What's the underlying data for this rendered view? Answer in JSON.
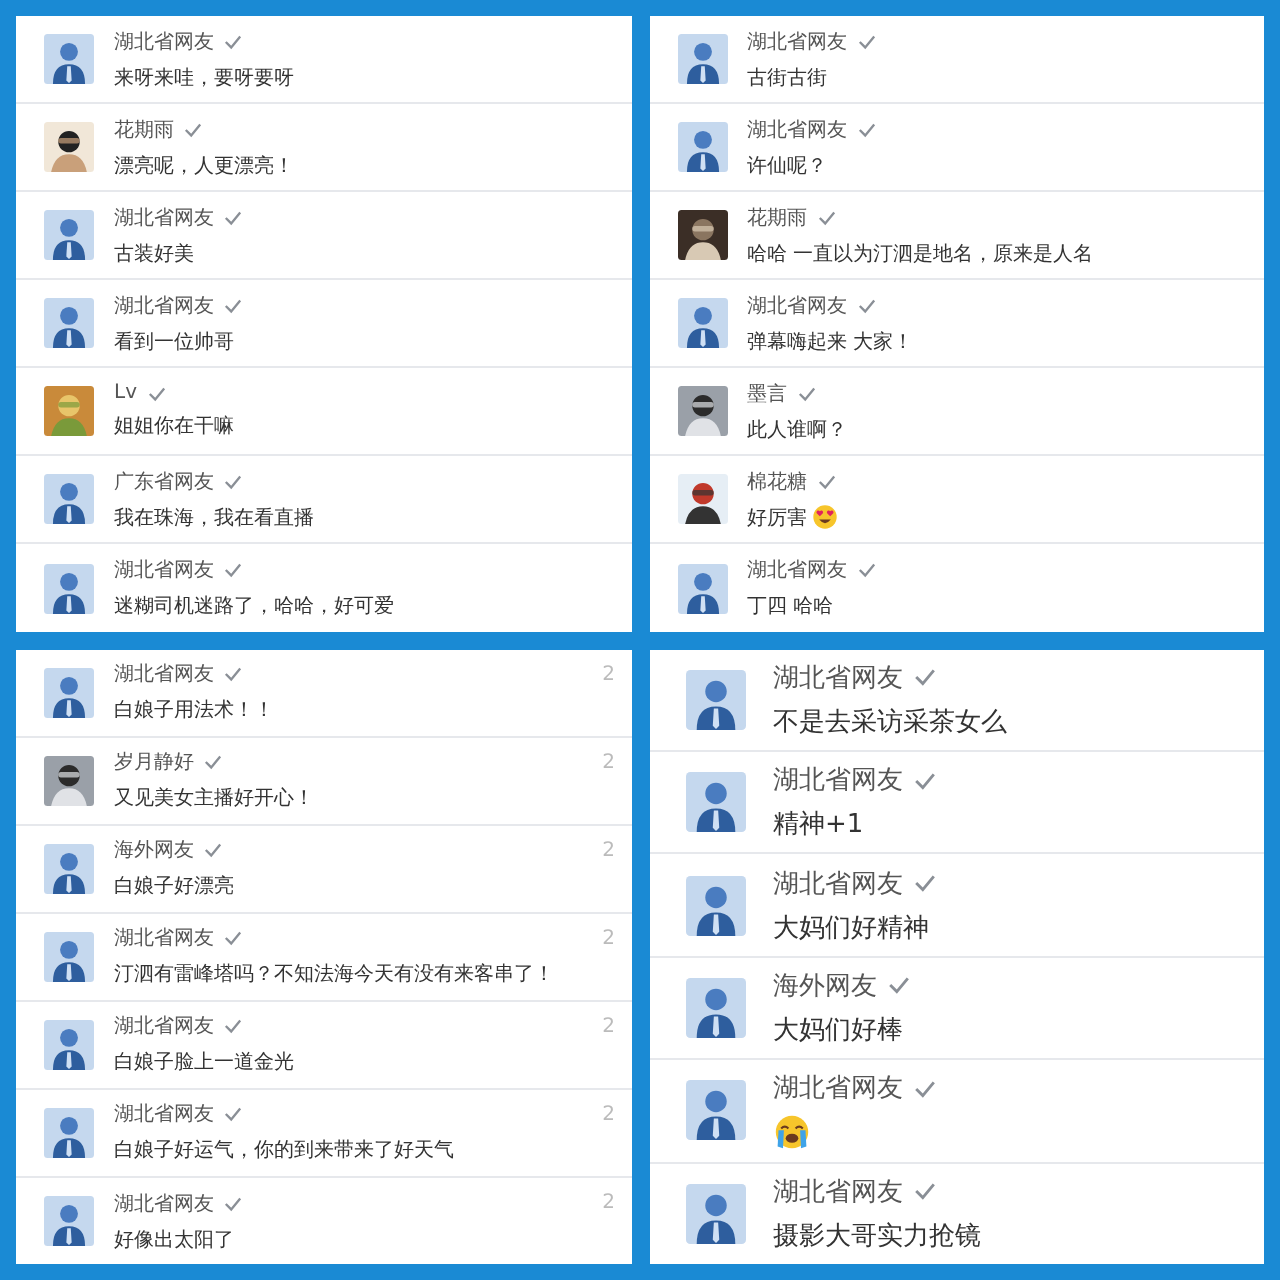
{
  "panels": [
    {
      "comments": [
        {
          "avatar": {
            "kind": "default"
          },
          "name": "湖北省网友",
          "text": "来呀来哇，要呀要呀"
        },
        {
          "name": "花期雨",
          "text": "漂亮呢，人更漂亮！"
        },
        {
          "avatar": {
            "kind": "default"
          },
          "name": "湖北省网友",
          "text": "古装好美"
        },
        {
          "avatar": {
            "kind": "default"
          },
          "name": "湖北省网友",
          "text": "看到一位帅哥"
        },
        {
          "name": "Lv",
          "text": "姐姐你在干嘛"
        },
        {
          "avatar": {
            "kind": "default"
          },
          "name": "广东省网友",
          "text": "我在珠海，我在看直播"
        },
        {
          "avatar": {
            "kind": "default"
          },
          "name": "湖北省网友",
          "text": "迷糊司机迷路了，哈哈，好可爱"
        }
      ]
    },
    {
      "comments": [
        {
          "avatar": {
            "kind": "default"
          },
          "name": "湖北省网友",
          "text": "古街古街"
        },
        {
          "avatar": {
            "kind": "default"
          },
          "name": "湖北省网友",
          "text": "许仙呢？"
        },
        {
          "name": "花期雨",
          "text": "哈哈 一直以为汀泗是地名，原来是人名"
        },
        {
          "avatar": {
            "kind": "default"
          },
          "name": "湖北省网友",
          "text": "弹幕嗨起来 大家！"
        },
        {
          "name": "墨言",
          "text": "此人谁啊？"
        },
        {
          "name": "棉花糖",
          "text": "好厉害",
          "emoji": {
            "kind": "heart-eyes"
          }
        },
        {
          "avatar": {
            "kind": "default"
          },
          "name": "湖北省网友",
          "text": "丁四 哈哈"
        }
      ]
    },
    {
      "comments": [
        {
          "avatar": {
            "kind": "default"
          },
          "name": "湖北省网友",
          "text": "白娘子用法术！！",
          "time": "2"
        },
        {
          "name": "岁月静好",
          "text": "又见美女主播好开心！",
          "time": "2"
        },
        {
          "avatar": {
            "kind": "default"
          },
          "name": "海外网友",
          "text": "白娘子好漂亮",
          "time": "2"
        },
        {
          "avatar": {
            "kind": "default"
          },
          "name": "湖北省网友",
          "text": "汀泗有雷峰塔吗？不知法海今天有没有来客串了！",
          "time": "2"
        },
        {
          "avatar": {
            "kind": "default"
          },
          "name": "湖北省网友",
          "text": "白娘子脸上一道金光",
          "time": "2"
        },
        {
          "avatar": {
            "kind": "default"
          },
          "name": "湖北省网友",
          "text": "白娘子好运气，你的到来带来了好天气",
          "time": "2"
        },
        {
          "avatar": {
            "kind": "default"
          },
          "name": "湖北省网友",
          "text": "好像出太阳了",
          "time": "2"
        }
      ]
    },
    {
      "comments": [
        {
          "avatar": {
            "kind": "default"
          },
          "name": "湖北省网友",
          "text": "不是去采访采茶女么"
        },
        {
          "avatar": {
            "kind": "default"
          },
          "name": "湖北省网友",
          "text": "精神+1"
        },
        {
          "avatar": {
            "kind": "default"
          },
          "name": "湖北省网友",
          "text": "大妈们好精神"
        },
        {
          "avatar": {
            "kind": "default"
          },
          "name": "海外网友",
          "text": "大妈们好棒"
        },
        {
          "avatar": {
            "kind": "default"
          },
          "name": "湖北省网友",
          "emoji": {
            "kind": "crying"
          }
        },
        {
          "avatar": {
            "kind": "default"
          },
          "name": "湖北省网友",
          "text": "摄影大哥实力抢镜"
        }
      ]
    }
  ]
}
